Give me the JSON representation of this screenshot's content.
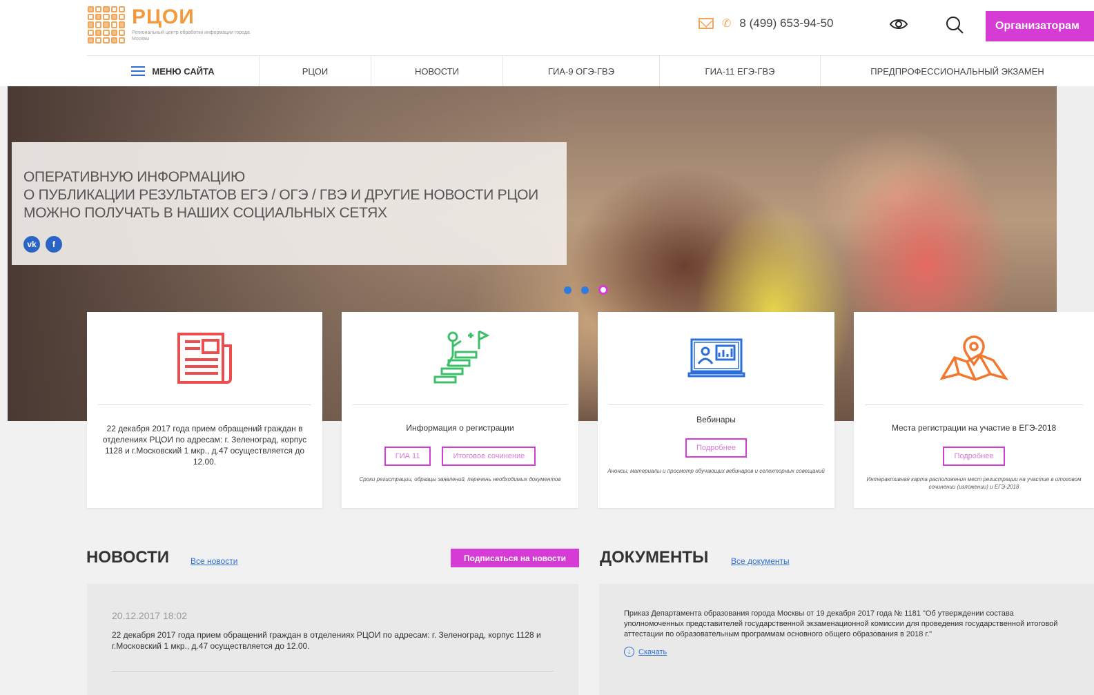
{
  "header": {
    "logo_name": "РЦОИ",
    "logo_sub": "Региональный центр обработки информации города Москвы",
    "phone": "8 (499) 653-94-50",
    "org_button": "Организаторам"
  },
  "nav": {
    "items": [
      {
        "label": "Меню сайта"
      },
      {
        "label": "РЦОИ"
      },
      {
        "label": "Новости"
      },
      {
        "label": "ГИА-9 ОГЭ-ГВЭ"
      },
      {
        "label": "ГИА-11 ЕГЭ-ГВЭ"
      },
      {
        "label": "Предпрофессиональный экзамен"
      }
    ]
  },
  "hero": {
    "lines": [
      "Оперативную информацию",
      "о публикации результатов ЕГЭ / ОГЭ / ГВЭ  и другие новости РЦОИ",
      "можно получать в наших социальных сетях"
    ],
    "social": [
      "vk",
      "f"
    ]
  },
  "cards": [
    {
      "text": "22 декабря 2017 года прием обращений граждан в отделениях РЦОИ по адресам: г. Зеленоград, корпус 1128 и г.Московский 1 мкр., д.47 осуществляется до 12.00."
    },
    {
      "title": "Информация о регистрации",
      "buttons": [
        "ГИА 11",
        "Итоговое сочинение"
      ],
      "note": "Сроки регистрации, образцы заявлений, перечень необходимых документов"
    },
    {
      "title": "Вебинары",
      "buttons": [
        "Подробнее"
      ],
      "note": "Анонсы, материалы и просмотр обучающих вебинаров и селекторных совещаний"
    },
    {
      "title": "Места регистрации на участие в ЕГЭ-2018",
      "buttons": [
        "Подробнее"
      ],
      "note": "Интерактивная карта расположения мест регистрации на участие в итоговом сочинении (изложении) и ЕГЭ-2018"
    }
  ],
  "news": {
    "title": "НОВОСТИ",
    "all_link": "Все новости",
    "subscribe": "Подписаться на новости",
    "item": {
      "date": "20.12.2017 18:02",
      "text": "22 декабря 2017 года прием обращений граждан в отделениях РЦОИ по адресам: г. Зеленоград, корпус 1128 и г.Московский 1 мкр., д.47  осуществляется до 12.00."
    }
  },
  "docs": {
    "title": "ДОКУМЕНТЫ",
    "all_link": "Все документы",
    "item": {
      "text": "Приказ Департамента образования города Москвы от 19 декабря 2017 года № 1181 \"Об утверждении состава уполномоченных представителей государственной экзаменационной комиссии для проведения государственной итоговой аттестации по образовательным программам основного общего образования в 2018 г.\"",
      "download": "Скачать"
    }
  },
  "colors": {
    "accent": "#d63bd6",
    "orange": "#f29a3d",
    "blue": "#2b6fd6",
    "red_icon": "#ef4d4d",
    "green_icon": "#3dbf6a"
  }
}
